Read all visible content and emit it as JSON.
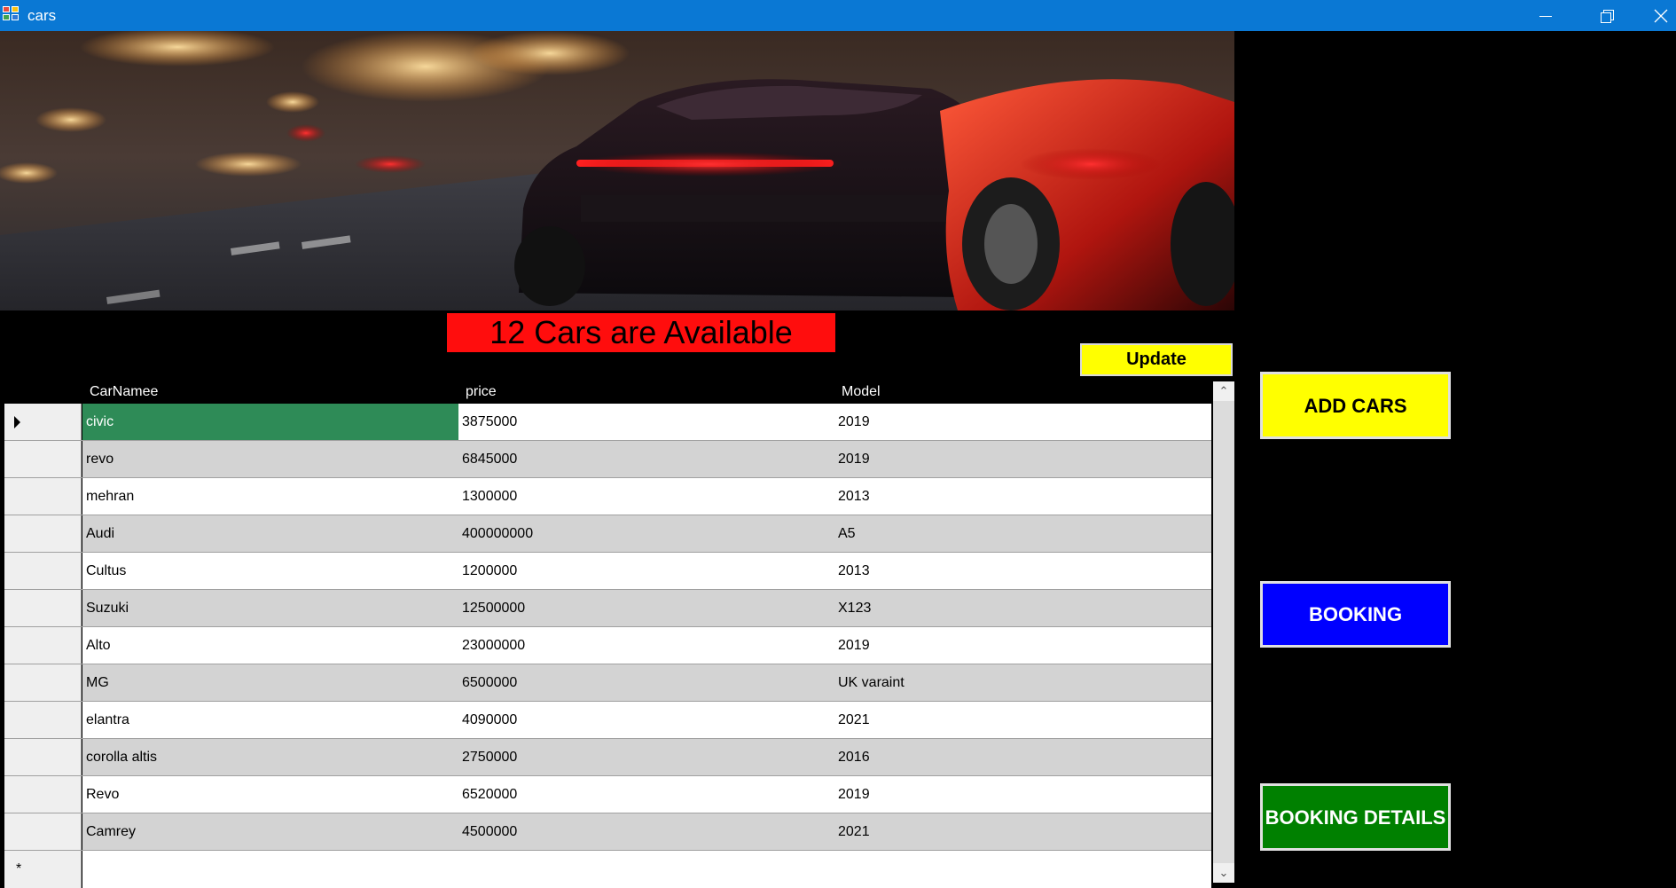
{
  "window": {
    "title": "cars",
    "minimize_icon": "minimize-icon",
    "maximize_icon": "restore-icon",
    "close_icon": "close-icon"
  },
  "heading": {
    "text": "12 Cars are Available",
    "background": "#ff0d0d"
  },
  "update_button": {
    "label": "Update",
    "color": "#ffff00"
  },
  "grid": {
    "columns": [
      "CarNamee",
      "price",
      "Model"
    ],
    "selected_cell_color": "#2e8b57",
    "rows": [
      {
        "name": "civic",
        "price": "3875000",
        "model": "2019"
      },
      {
        "name": "revo",
        "price": "6845000",
        "model": "2019"
      },
      {
        "name": "mehran",
        "price": "1300000",
        "model": "2013"
      },
      {
        "name": "Audi",
        "price": "400000000",
        "model": "A5"
      },
      {
        "name": "Cultus",
        "price": "1200000",
        "model": "2013"
      },
      {
        "name": "Suzuki",
        "price": "12500000",
        "model": "X123"
      },
      {
        "name": "Alto",
        "price": "23000000",
        "model": "2019"
      },
      {
        "name": "MG",
        "price": "6500000",
        "model": "UK varaint"
      },
      {
        "name": "elantra",
        "price": "4090000",
        "model": "2021"
      },
      {
        "name": "corolla altis",
        "price": "2750000",
        "model": "2016"
      },
      {
        "name": "Revo",
        "price": "6520000",
        "model": "2019"
      },
      {
        "name": "Camrey",
        "price": "4500000",
        "model": "2021"
      }
    ],
    "new_row_marker": "*"
  },
  "side_buttons": {
    "add_cars": {
      "label": "ADD CARS",
      "color": "#ffff00"
    },
    "booking": {
      "label": "BOOKING",
      "color": "#0000ff"
    },
    "booking_details": {
      "label": "BOOKING DETAILS",
      "color": "#008000"
    }
  }
}
